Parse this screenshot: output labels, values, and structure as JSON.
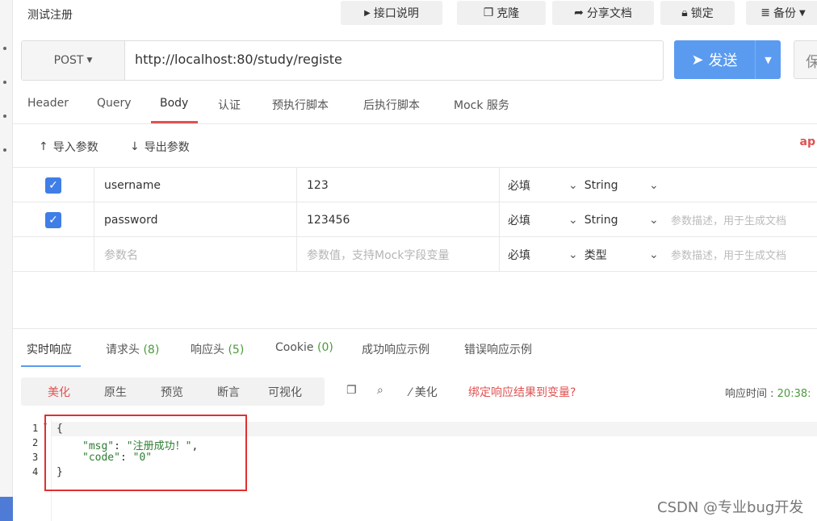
{
  "app": {
    "title": "测试注册"
  },
  "toolbar": {
    "api_doc": "接口说明",
    "clone": "克隆",
    "share": "分享文档",
    "lock": "锁定",
    "backup": "备份"
  },
  "request": {
    "method": "POST",
    "url": "http://localhost:80/study/registe",
    "send_label": "发送",
    "save_label": "保"
  },
  "tabs": [
    "Header",
    "Query",
    "Body",
    "认证",
    "预执行脚本",
    "后执行脚本",
    "Mock 服务"
  ],
  "active_tab": "Body",
  "body_tools": {
    "import": "导入参数",
    "export": "导出参数",
    "extra": "ap"
  },
  "params": [
    {
      "checked": true,
      "name": "username",
      "value": "123",
      "required": "必填",
      "type": "String",
      "desc": ""
    },
    {
      "checked": true,
      "name": "password",
      "value": "123456",
      "required": "必填",
      "type": "String",
      "desc": "参数描述，用于生成文档"
    }
  ],
  "param_placeholder": {
    "name": "参数名",
    "value": "参数值，支持Mock字段变量",
    "required": "必填",
    "type": "类型",
    "desc": "参数描述，用于生成文档"
  },
  "response_tabs": [
    {
      "label": "实时响应",
      "count": ""
    },
    {
      "label": "请求头",
      "count": "(8)"
    },
    {
      "label": "响应头",
      "count": "(5)"
    },
    {
      "label": "Cookie",
      "count": "(0)"
    },
    {
      "label": "成功响应示例",
      "count": ""
    },
    {
      "label": "错误响应示例",
      "count": ""
    }
  ],
  "format_tabs": [
    "美化",
    "原生",
    "预览",
    "断言",
    "可视化"
  ],
  "format_tools": {
    "beautify": "美化",
    "bind": "绑定响应结果到变量?"
  },
  "response_time": {
    "label": "响应时间 : ",
    "value": "20:38:"
  },
  "response_body": {
    "lines": [
      "1",
      "2",
      "3",
      "4"
    ],
    "open": "{",
    "msg_key": "\"msg\"",
    "msg_val": "\"注册成功！\"",
    "code_key": "\"code\"",
    "code_val": "\"0\"",
    "close": "}"
  },
  "watermark": "CSDN @专业bug开发",
  "colors": {
    "accent": "#5a9bf0",
    "active_red": "#e05252",
    "check_blue": "#3e7ee6",
    "highlight_box": "#e03030"
  }
}
